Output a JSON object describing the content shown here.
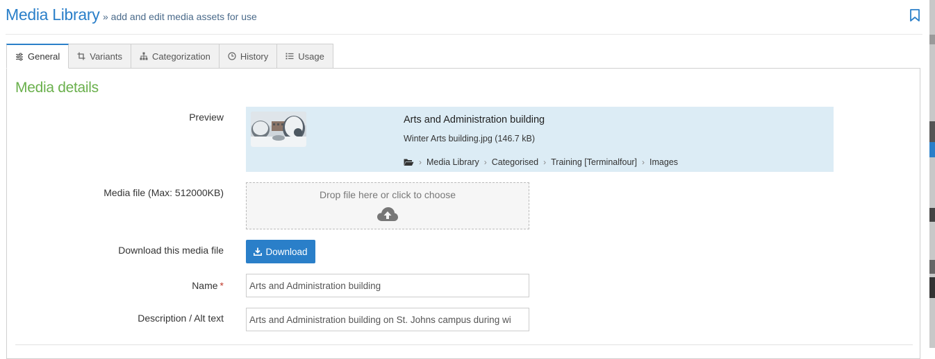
{
  "header": {
    "title": "Media Library",
    "subtitle": "» add and edit media assets for use"
  },
  "tabs": [
    {
      "label": "General",
      "icon": "sliders-icon",
      "active": true
    },
    {
      "label": "Variants",
      "icon": "crop-icon"
    },
    {
      "label": "Categorization",
      "icon": "sitemap-icon"
    },
    {
      "label": "History",
      "icon": "clock-icon"
    },
    {
      "label": "Usage",
      "icon": "list-icon"
    }
  ],
  "section": {
    "title": "Media details"
  },
  "preview": {
    "label": "Preview",
    "asset_title": "Arts and Administration building",
    "file_info": "Winter Arts building.jpg (146.7 kB)",
    "breadcrumb": [
      "Media Library",
      "Categorised",
      "Training [Terminalfour]",
      "Images"
    ]
  },
  "media_file": {
    "label": "Media file (Max: 512000KB)",
    "dropzone_text": "Drop file here or click to choose"
  },
  "download": {
    "label": "Download this media file",
    "button_label": "Download"
  },
  "name_field": {
    "label": "Name",
    "required_mark": "*",
    "value": "Arts and Administration building"
  },
  "description_field": {
    "label": "Description / Alt text",
    "value": "Arts and Administration building on St. Johns campus during wi"
  },
  "colors": {
    "accent_blue": "#2a7fc9",
    "section_green": "#6ab04c",
    "preview_bg": "#dcecf5"
  }
}
